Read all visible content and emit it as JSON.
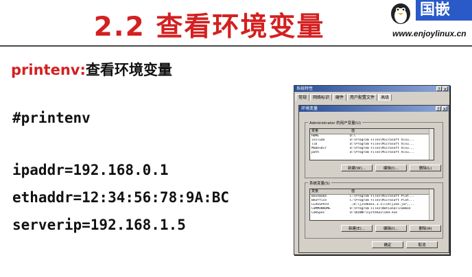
{
  "slide": {
    "title": "2.2 查看环境变量",
    "heading_cmd": "printenv:",
    "heading_desc": "查看环境变量",
    "lines": [
      "#printenv",
      "ipaddr=192.168.0.1",
      "ethaddr=12:34:56:78:9A:BC",
      "serverip=192.168.1.5"
    ]
  },
  "logo": {
    "brand": "国嵌",
    "url": "www.enjoylinux.cn"
  },
  "dialog": {
    "title": "系统特性",
    "help_btn": "?",
    "close_btn": "×",
    "tabs": [
      "常规",
      "网络标识",
      "硬件",
      "用户配置文件",
      "高级"
    ],
    "inner_title": "环境变量",
    "user_group_label": "Administrator 的用户变量(U)",
    "sys_group_label": "系统变量(S)",
    "col_var": "变量",
    "col_val": "值",
    "user_vars": [
      {
        "name": "HOME",
        "value": "D:\\"
      },
      {
        "name": "include",
        "value": "D:\\Program Files\\Microsoft Visu..."
      },
      {
        "name": "lib",
        "value": "D:\\Program Files\\Microsoft Visu..."
      },
      {
        "name": "MSDevDir",
        "value": "D:\\Program Files\\Microsoft Visu..."
      },
      {
        "name": "path",
        "value": "D:\\Program Files\\Microsoft Visu..."
      }
    ],
    "sys_vars": [
      {
        "name": "Basemake",
        "value": "C:\\Program Files\\Microsoft Plat..."
      },
      {
        "name": "Bkoffice",
        "value": "C:\\Program Files\\Microsoft Plat..."
      },
      {
        "name": "CLASSPATH",
        "value": ".;D:\\j2sdkee1.3.1\\lib\\j2ee.jar;..."
      },
      {
        "name": "COMMONHOME",
        "value": "D:\\Program Files\\National\\common"
      },
      {
        "name": "ComSpec",
        "value": "D:\\WINNT\\system32\\cmd.exe"
      }
    ],
    "btn_new": "新建(W)...",
    "btn_edit": "编辑(I)...",
    "btn_delete": "删除(L)",
    "btn_new2": "新建(E)...",
    "btn_edit2": "编辑(I)...",
    "btn_delete2": "删除(A)",
    "btn_ok": "确定",
    "btn_cancel": "取消"
  }
}
